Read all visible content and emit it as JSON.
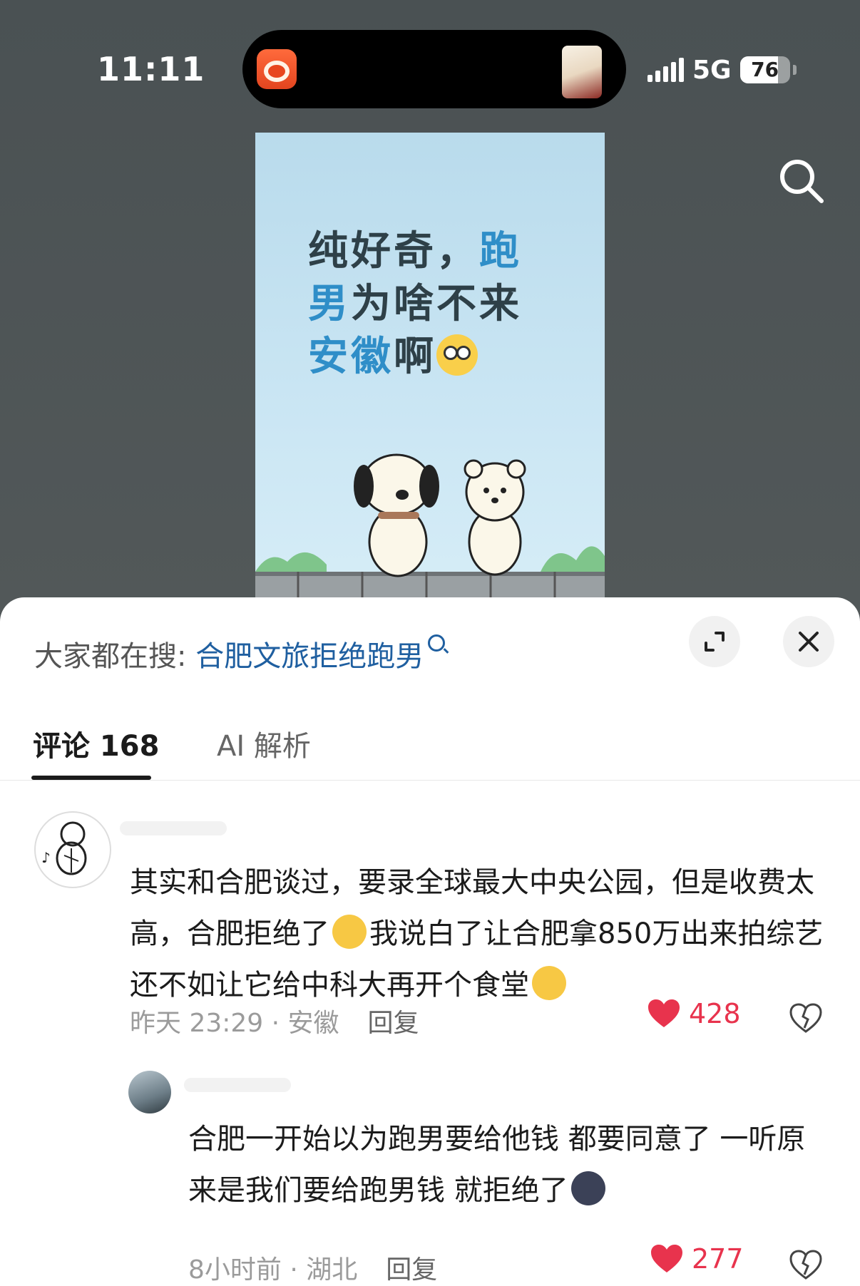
{
  "status_bar": {
    "time": "11:11",
    "network": "5G",
    "battery_level": "76",
    "battery_fraction": 0.76
  },
  "cover": {
    "headline_part1": "纯好奇，",
    "headline_part2": "跑",
    "headline_part3": "男",
    "headline_part4": "为啥不来",
    "headline_part5": "安徽",
    "headline_part6": "啊"
  },
  "sheet": {
    "hot_label": "大家都在搜: ",
    "hot_query": "合肥文旅拒绝跑男",
    "tabs": [
      {
        "label": "评论 168"
      },
      {
        "label": "AI 解析"
      }
    ]
  },
  "comments": [
    {
      "text_a": "其实和合肥谈过，要录全球最大中央公园，但是收费太高，合肥拒绝了",
      "text_b": "我说白了让合肥拿850万出来拍综艺还不如让它给中科大再开个食堂",
      "time_location": "昨天 23:29 · 安徽",
      "reply_label": "回复",
      "likes": "428"
    },
    {
      "text_a": "合肥一开始以为跑男要给他钱 都要同意了 一听原来是我们要给跑男钱 就拒绝了",
      "time_location": "8小时前 · 湖北",
      "reply_label": "回复",
      "likes": "277"
    }
  ],
  "colors": {
    "accent_link": "#1f5fa0",
    "like_red": "#e8334d"
  }
}
